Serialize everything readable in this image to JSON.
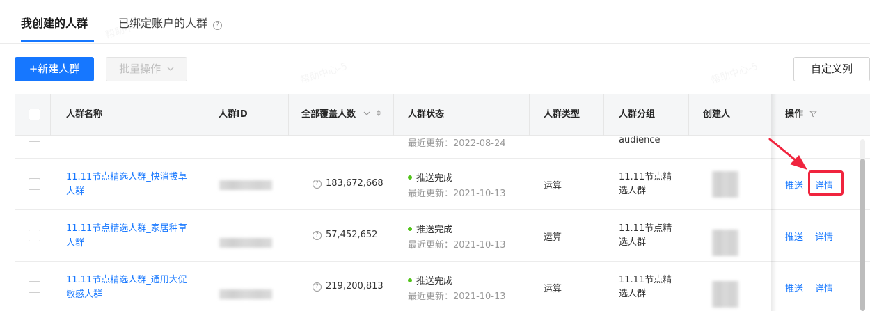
{
  "tabs": [
    {
      "label": "我创建的人群",
      "active": true
    },
    {
      "label": "已绑定账户的人群",
      "active": false
    }
  ],
  "help_icon_glyph": "?",
  "toolbar": {
    "new_label": "+新建人群",
    "batch_label": "批量操作",
    "customize_label": "自定义列"
  },
  "table": {
    "headers": {
      "name": "人群名称",
      "id": "人群ID",
      "coverage": "全部覆盖人数",
      "status": "人群状态",
      "type": "人群类型",
      "group": "人群分组",
      "creator": "创建人",
      "actions": "操作"
    },
    "partial_row": {
      "updated": "最近更新：2022-08-24",
      "group": "audience"
    },
    "rows": [
      {
        "name_line1": "11.11节点精选人群_快消拔草",
        "name_line2": "人群",
        "coverage": "183,672,668",
        "status": "推送完成",
        "updated": "最近更新：2021-10-13",
        "type": "运算",
        "group_line1": "11.11节点精",
        "group_line2": "选人群",
        "push": "推送",
        "detail": "详情"
      },
      {
        "name_line1": "11.11节点精选人群_家居种草",
        "name_line2": "人群",
        "coverage": "57,452,652",
        "status": "推送完成",
        "updated": "最近更新：2021-10-13",
        "type": "运算",
        "group_line1": "11.11节点精",
        "group_line2": "选人群",
        "push": "推送",
        "detail": "详情"
      },
      {
        "name_line1": "11.11节点精选人群_通用大促",
        "name_line2": "敏感人群",
        "coverage": "219,200,813",
        "status": "推送完成",
        "updated": "最近更新：2021-10-13",
        "type": "运算",
        "group_line1": "11.11节点精",
        "group_line2": "选人群",
        "push": "推送",
        "detail": "详情"
      }
    ]
  },
  "colors": {
    "primary": "#1677ff",
    "success": "#52c41a",
    "annotation": "#f0243e"
  }
}
